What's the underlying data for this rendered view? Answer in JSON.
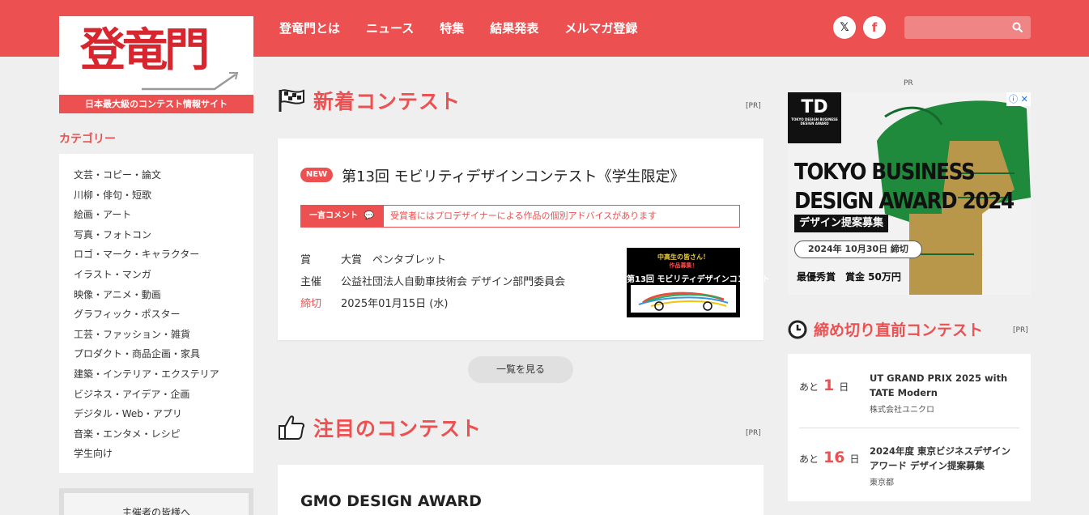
{
  "logo": {
    "text": "登竜門",
    "tagline": "日本最大級のコンテスト情報サイト"
  },
  "nav": {
    "items": [
      "登竜門とは",
      "ニュース",
      "特集",
      "結果発表",
      "メルマガ登録"
    ]
  },
  "social": {
    "x_label": "𝕏",
    "facebook_label": "f"
  },
  "search": {
    "placeholder": "",
    "icon": "search-icon"
  },
  "sidebar": {
    "heading": "カテゴリー",
    "categories": [
      "文芸・コピー・論文",
      "川柳・俳句・短歌",
      "絵画・アート",
      "写真・フォトコン",
      "ロゴ・マーク・キャラクター",
      "イラスト・マンガ",
      "映像・アニメ・動画",
      "グラフィック・ポスター",
      "工芸・ファッション・雑貨",
      "プロダクト・商品企画・家具",
      "建築・インテリア・エクステリア",
      "ビジネス・アイデア・企画",
      "デジタル・Web・アプリ",
      "音楽・エンタメ・レシピ",
      "学生向け"
    ],
    "organizer_label": "主催者の皆様へ"
  },
  "new_contests": {
    "heading": "新着コンテスト",
    "pr": "[PR]",
    "card": {
      "badge": "NEW",
      "title": "第13回 モビリティデザインコンテスト《学生限定》",
      "comment_label": "一言コメント",
      "comment_text": "受賞者にはプロデザイナーによる作品の個別アドバイスがあります",
      "prize_key": "賞",
      "prize_value": "大賞　ペンタブレット",
      "host_key": "主催",
      "host_value": "公益社団法人自動車技術会 デザイン部門委員会",
      "deadline_key": "締切",
      "deadline_value": "2025年01月15日 (水)",
      "thumb_line1": "中高生の皆さん！",
      "thumb_line2": "作品募集！",
      "thumb_line3": "第13回 モビリティデザインコンテスト"
    },
    "more_button": "一覧を見る"
  },
  "featured": {
    "heading": "注目のコンテスト",
    "pr": "[PR]",
    "first_title": "GMO DESIGN AWARD"
  },
  "ad": {
    "pr": "PR",
    "logo": "TD",
    "logo_sub": "TOKYO DESIGN BUSINESS DESIGN AWARD",
    "title_line1": "TOKYO BUSINESS",
    "title_line2": "DESIGN AWARD 2024",
    "sub": "デザイン提案募集",
    "date": "2024年 10月30日 締切",
    "prize": "最優秀賞　賞金 50万円",
    "colors": {
      "green": "#1f8a3c",
      "gold": "#b8974a"
    }
  },
  "deadline": {
    "heading": "締め切り直前コンテスト",
    "pr": "[PR]",
    "items": [
      {
        "prefix": "あと",
        "days": "1",
        "suffix": "日",
        "title": "UT GRAND PRIX 2025 with TATE Modern",
        "org": "株式会社ユニクロ"
      },
      {
        "prefix": "あと",
        "days": "16",
        "suffix": "日",
        "title": "2024年度 東京ビジネスデザインアワード デザイン提案募集",
        "org": "東京都"
      }
    ]
  },
  "colors": {
    "accent": "#ec5050",
    "background": "#efefef"
  }
}
